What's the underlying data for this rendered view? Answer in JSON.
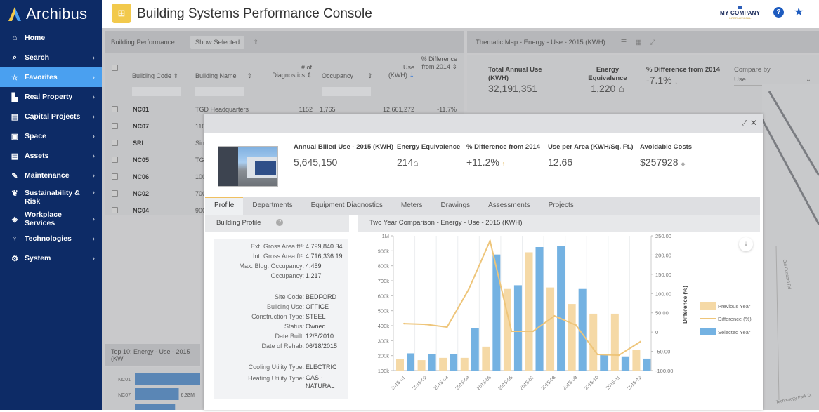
{
  "app": {
    "logo_text": "Archibus",
    "page_title": "Building Systems Performance Console",
    "company_name": "MY COMPANY",
    "company_sub": "INTERNATIONAL",
    "accent_color": "#4aa0f0",
    "sidebar_color": "#0d2b66"
  },
  "sidebar": {
    "items": [
      {
        "label": "Home",
        "icon": "home-icon",
        "chevron": false
      },
      {
        "label": "Search",
        "icon": "search-icon",
        "chevron": true
      },
      {
        "label": "Favorites",
        "icon": "star-icon",
        "chevron": true,
        "active": true
      },
      {
        "label": "Real Property",
        "icon": "building-icon",
        "chevron": true
      },
      {
        "label": "Capital Projects",
        "icon": "chart-icon",
        "chevron": true
      },
      {
        "label": "Space",
        "icon": "floorplan-icon",
        "chevron": true
      },
      {
        "label": "Assets",
        "icon": "document-icon",
        "chevron": true
      },
      {
        "label": "Maintenance",
        "icon": "wrench-icon",
        "chevron": true
      },
      {
        "label": "Sustainability & Risk",
        "icon": "leaf-icon",
        "chevron": true
      },
      {
        "label": "Workplace Services",
        "icon": "services-icon",
        "chevron": true
      },
      {
        "label": "Technologies",
        "icon": "bulb-icon",
        "chevron": true
      },
      {
        "label": "System",
        "icon": "gear-icon",
        "chevron": true
      }
    ],
    "chevron_glyph": "›"
  },
  "building_performance": {
    "title": "Building Performance",
    "show_selected": "Show Selected",
    "columns": [
      "Building Code",
      "Building Name",
      "# of Diagnostics",
      "Occupancy",
      "Use (KWH)",
      "% Difference from 2014"
    ],
    "rows": [
      {
        "code": "NC01",
        "name": "TGD Headquarters",
        "diagnostics": "1152",
        "occupancy": "1,765",
        "use": "12,661,272",
        "diff": "-11.7%"
      },
      {
        "code": "NC07",
        "name": "110",
        "diagnostics": "",
        "occupancy": "",
        "use": "",
        "diff": ""
      },
      {
        "code": "SRL",
        "name": "Sin",
        "diagnostics": "",
        "occupancy": "",
        "use": "",
        "diff": ""
      },
      {
        "code": "NC05",
        "name": "TG",
        "diagnostics": "",
        "occupancy": "",
        "use": "",
        "diff": ""
      },
      {
        "code": "NC06",
        "name": "100",
        "diagnostics": "",
        "occupancy": "",
        "use": "",
        "diff": ""
      },
      {
        "code": "NC02",
        "name": "700",
        "diagnostics": "",
        "occupancy": "",
        "use": "",
        "diff": ""
      },
      {
        "code": "NC04",
        "name": "900",
        "diagnostics": "",
        "occupancy": "",
        "use": "",
        "diff": ""
      }
    ]
  },
  "thematic_map": {
    "title": "Thematic Map - Energy - Use - 2015 (KWH)",
    "kpis": [
      {
        "label": "Total Annual Use (KWH)",
        "value": "32,191,351"
      },
      {
        "label": "Energy Equivalence",
        "value": "1,220"
      },
      {
        "label": "% Difference from 2014",
        "value": "-7.1%"
      }
    ],
    "compare_by_label": "Compare by",
    "compare_by_value": "Use",
    "map_labels": [
      "Old Concord Rd",
      "Technology Park Dr"
    ]
  },
  "top10": {
    "title": "Top 10: Energy - Use - 2015 (KW",
    "rows": [
      {
        "label": "NC01",
        "value": 12.66,
        "value_label": ""
      },
      {
        "label": "NC07",
        "value": 6.33,
        "value_label": "6.33M"
      },
      {
        "label": "",
        "value": 5.8,
        "value_label": ""
      }
    ]
  },
  "modal": {
    "kpis": [
      {
        "label": "Annual Billed Use - 2015 (KWH)",
        "value": "5,645,150",
        "icon": ""
      },
      {
        "label": "Energy Equivalence",
        "value": "214",
        "icon": "home-icon"
      },
      {
        "label": "% Difference from 2014",
        "value": "+11.2%",
        "icon": "arrow-up-icon"
      },
      {
        "label": "Use per Area (KWH/Sq. Ft.)",
        "value": "12.66",
        "icon": ""
      },
      {
        "label": "Avoidable Costs",
        "value": "$257928",
        "icon": "dot-icon"
      }
    ],
    "tabs": [
      "Profile",
      "Departments",
      "Equipment Diagnostics",
      "Meters",
      "Drawings",
      "Assessments",
      "Projects"
    ],
    "active_tab": "Profile",
    "profile_title": "Building Profile",
    "chart_title": "Two Year Comparison - Energy - Use - 2015 (KWH)",
    "profile": [
      {
        "label": "Ext. Gross Area ft²:",
        "value": "4,799,840.34"
      },
      {
        "label": "Int. Gross Area ft²:",
        "value": "4,716,336.19"
      },
      {
        "label": "Max. Bldg. Occupancy:",
        "value": "4,459"
      },
      {
        "label": "Occupancy:",
        "value": "1,217"
      },
      {
        "label": "Site Code:",
        "value": "BEDFORD"
      },
      {
        "label": "Building Use:",
        "value": "OFFICE"
      },
      {
        "label": "Construction Type:",
        "value": "STEEL"
      },
      {
        "label": "Status:",
        "value": "Owned"
      },
      {
        "label": "Date Built:",
        "value": "12/8/2010"
      },
      {
        "label": "Date of Rehab:",
        "value": "06/18/2015"
      },
      {
        "label": "Cooling Utility Type:",
        "value": "ELECTRIC"
      },
      {
        "label": "Heating Utility Type:",
        "value": "GAS - NATURAL"
      }
    ]
  },
  "chart_data": {
    "type": "bar",
    "title": "Two Year Comparison - Energy - Use - 2015 (KWH)",
    "categories": [
      "2015-01",
      "2015-02",
      "2015-03",
      "2015-04",
      "2015-05",
      "2015-06",
      "2015-07",
      "2015-08",
      "2015-09",
      "2015-10",
      "2015-11",
      "2015-12"
    ],
    "series": [
      {
        "name": "Previous Year",
        "kind": "bar",
        "axis": "left",
        "color": "#f5d9a6",
        "values": [
          175000,
          170000,
          185000,
          185000,
          260000,
          645000,
          890000,
          655000,
          545000,
          480000,
          480000,
          240000
        ]
      },
      {
        "name": "Selected Year",
        "kind": "bar",
        "axis": "left",
        "color": "#74b2e2",
        "values": [
          215000,
          210000,
          210000,
          385000,
          875000,
          670000,
          925000,
          930000,
          645000,
          205000,
          195000,
          180000
        ]
      },
      {
        "name": "Difference (%)",
        "kind": "line",
        "axis": "right",
        "color": "#eec57a",
        "values": [
          22,
          20,
          13,
          110,
          237,
          2,
          2,
          42,
          18,
          -58,
          -60,
          -25
        ]
      }
    ],
    "left_axis": {
      "ticks": [
        "100k",
        "200k",
        "300k",
        "400k",
        "500k",
        "600k",
        "700k",
        "800k",
        "900k",
        "1M"
      ],
      "ylim": [
        100000,
        1000000
      ]
    },
    "right_axis": {
      "label": "Difference (%)",
      "ticks": [
        "-100.00",
        "-50.00",
        "0",
        "50.00",
        "100.00",
        "150.00",
        "200.00",
        "250.00"
      ],
      "ylim": [
        -100,
        250
      ]
    },
    "legend": [
      "Previous Year",
      "Difference (%)",
      "Selected Year"
    ],
    "legend_position": "right",
    "grid": "vertical"
  }
}
